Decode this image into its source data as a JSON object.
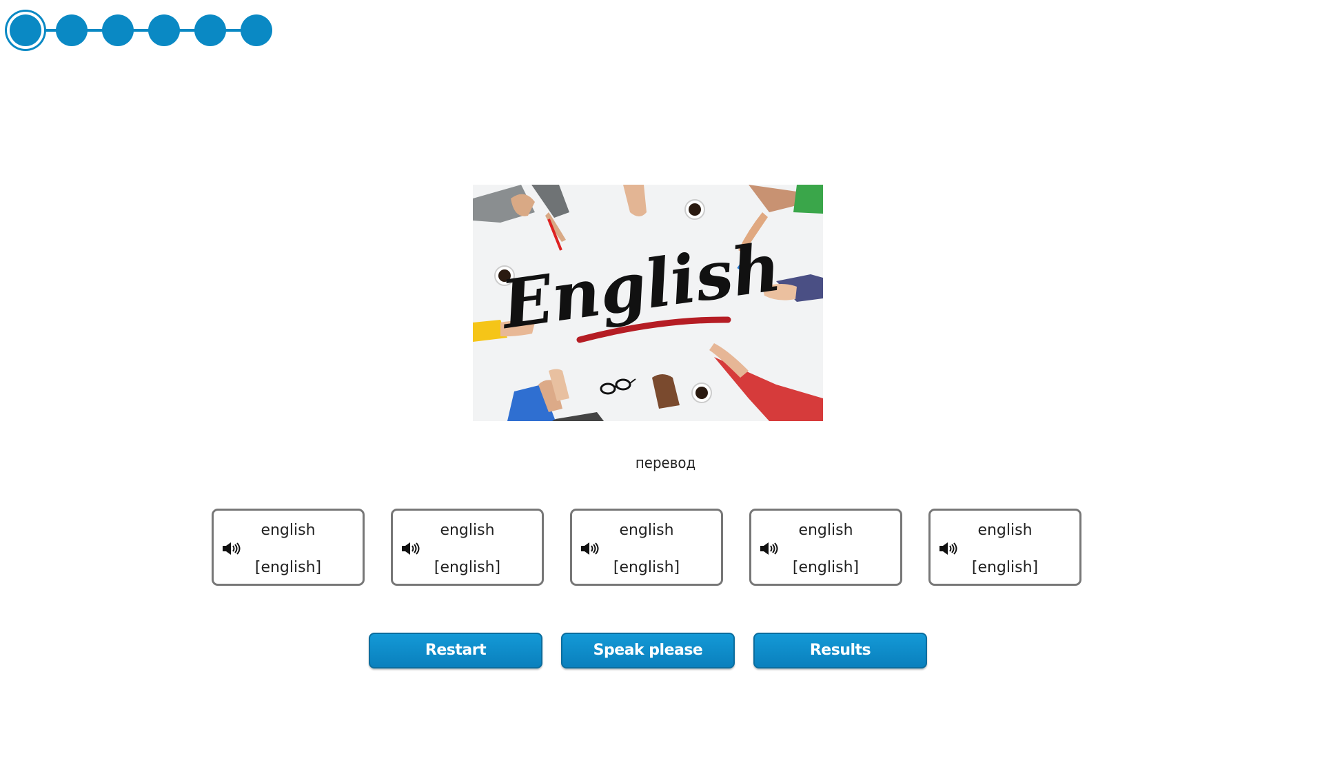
{
  "progress": {
    "total_steps": 6,
    "current_step": 1
  },
  "picture": {
    "label": "English"
  },
  "prompt": {
    "text": "перевод"
  },
  "cards": [
    {
      "word": "english",
      "transcription": "[english]"
    },
    {
      "word": "english",
      "transcription": "[english]"
    },
    {
      "word": "english",
      "transcription": "[english]"
    },
    {
      "word": "english",
      "transcription": "[english]"
    },
    {
      "word": "english",
      "transcription": "[english]"
    }
  ],
  "buttons": {
    "restart": "Restart",
    "speak": "Speak please",
    "results": "Results"
  },
  "colors": {
    "accent": "#0a89c4",
    "card_border": "#777777"
  },
  "icons": {
    "speaker": "speaker-icon"
  }
}
